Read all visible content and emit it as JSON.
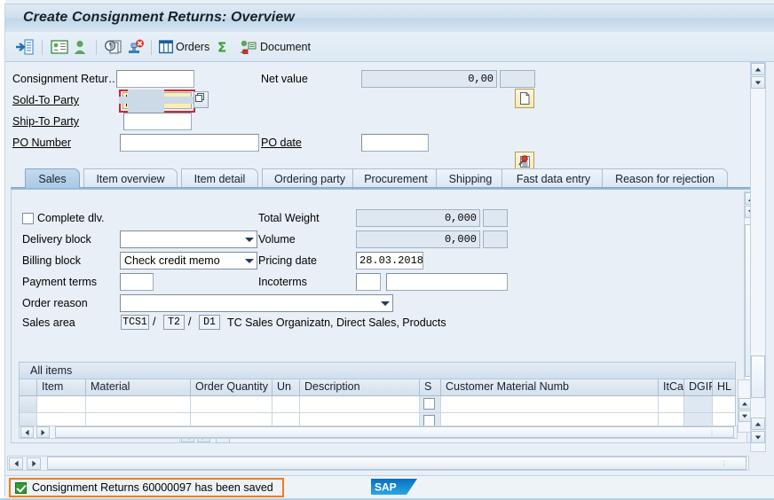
{
  "window": {
    "title": "Create Consignment Returns: Overview"
  },
  "toolbar": {
    "items": [
      {
        "name": "back-enter-icon",
        "icon": "enter-arrow",
        "label": ""
      },
      {
        "name": "create-with-reference-icon",
        "icon": "card-list",
        "label": ""
      },
      {
        "name": "business-partner-icon",
        "icon": "person",
        "label": ""
      },
      {
        "name": "availability-icon",
        "icon": "clock-doc",
        "label": ""
      },
      {
        "name": "reject-icon",
        "icon": "stamp-reject",
        "label": ""
      },
      {
        "name": "orders-button",
        "icon": "grid-table",
        "label": "Orders"
      },
      {
        "name": "sum-icon",
        "icon": "sigma",
        "label": ""
      },
      {
        "name": "document-button",
        "icon": "document-lock",
        "label": "Document"
      }
    ]
  },
  "header_form": {
    "consignment_return_label": "Consignment Retur…",
    "consignment_return_value": "",
    "sold_to_party_label": "Sold-To Party",
    "sold_to_party_value": "",
    "ship_to_party_label": "Ship-To Party",
    "ship_to_party_value": "",
    "po_number_label": "PO Number",
    "po_number_value": "",
    "net_value_label": "Net value",
    "net_value": "0,00",
    "net_value_currency": "",
    "po_date_label": "PO date",
    "po_date_value": "",
    "document_button_icon": "blank-document-icon",
    "search_button_icon": "display-doc-header-icon"
  },
  "tabs": [
    {
      "label": "Sales",
      "selected": true
    },
    {
      "label": "Item overview",
      "selected": false
    },
    {
      "label": "Item detail",
      "selected": false
    },
    {
      "label": "Ordering party",
      "selected": false
    },
    {
      "label": "Procurement",
      "selected": false
    },
    {
      "label": "Shipping",
      "selected": false
    },
    {
      "label": "Fast data entry",
      "selected": false
    },
    {
      "label": "Reason for rejection",
      "selected": false
    }
  ],
  "sales_tab": {
    "complete_dlv_label": "Complete dlv.",
    "complete_dlv_checked": false,
    "delivery_block_label": "Delivery block",
    "delivery_block_value": "",
    "billing_block_label": "Billing block",
    "billing_block_value": "Check credit memo",
    "payment_terms_label": "Payment terms",
    "payment_terms_value": "",
    "order_reason_label": "Order reason",
    "order_reason_value": "",
    "sales_area_label": "Sales area",
    "sales_area_org": "TCS1",
    "sales_area_channel": "T2",
    "sales_area_division": "D1",
    "sales_area_separator": "/",
    "sales_area_text": "TC Sales Organizatn, Direct Sales, Products",
    "total_weight_label": "Total Weight",
    "total_weight_value": "0,000",
    "total_weight_unit": "",
    "volume_label": "Volume",
    "volume_value": "0,000",
    "volume_unit": "",
    "pricing_date_label": "Pricing date",
    "pricing_date_value": "28.03.2018",
    "incoterms_label": "Incoterms",
    "incoterms_code": "",
    "incoterms_text": ""
  },
  "items_table": {
    "title": "All items",
    "columns": [
      {
        "key": "rowhdr",
        "label": ""
      },
      {
        "key": "item",
        "label": "Item"
      },
      {
        "key": "material",
        "label": "Material"
      },
      {
        "key": "order_quantity",
        "label": "Order Quantity"
      },
      {
        "key": "un",
        "label": "Un"
      },
      {
        "key": "description",
        "label": "Description"
      },
      {
        "key": "s",
        "label": "S"
      },
      {
        "key": "customer_material_numb",
        "label": "Customer Material Numb"
      },
      {
        "key": "itca",
        "label": "ItCa"
      },
      {
        "key": "dgip",
        "label": "DGIP"
      },
      {
        "key": "hl_itm",
        "label": "HL Itm"
      }
    ],
    "rows": [
      {
        "item": "",
        "material": "",
        "order_quantity": "",
        "un": "",
        "description": "",
        "s": false,
        "customer_material_numb": "",
        "itca": "",
        "dgip": "",
        "hl_itm": ""
      },
      {
        "item": "",
        "material": "",
        "order_quantity": "",
        "un": "",
        "description": "",
        "s": false,
        "customer_material_numb": "",
        "itca": "",
        "dgip": "",
        "hl_itm": ""
      }
    ]
  },
  "status_bar": {
    "message": "Consignment Returns 60000097 has been saved",
    "message_type": "success",
    "highlight_color": "#ef7d1a",
    "success_color": "#2e9b2e",
    "logo_text": "SAP"
  }
}
